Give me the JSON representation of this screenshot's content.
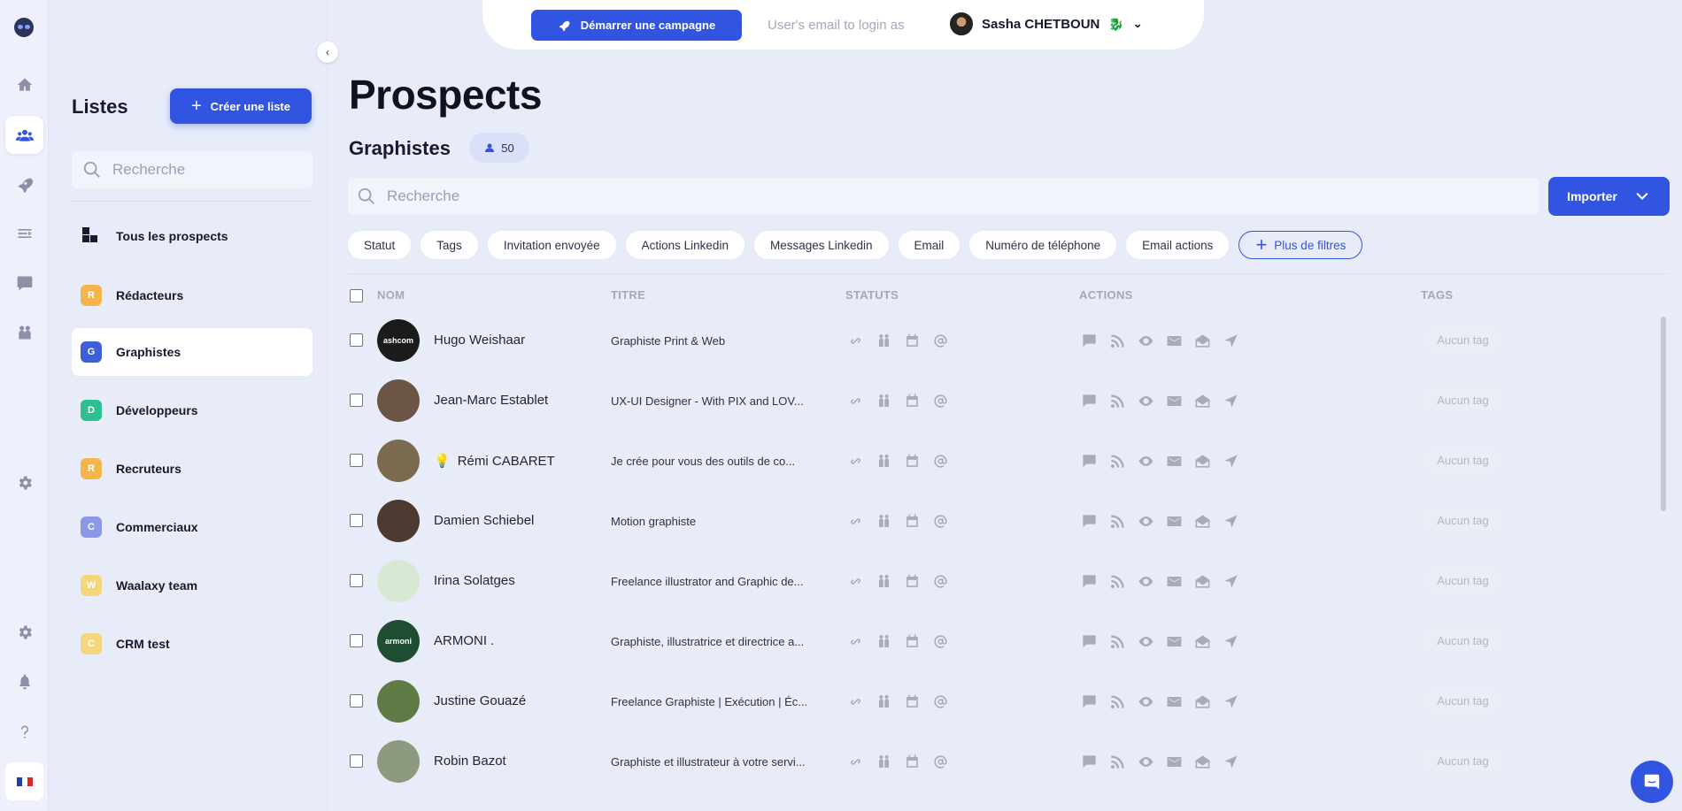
{
  "topbar": {
    "start_campaign": "Démarrer une campagne",
    "login_as_placeholder": "User's email to login as",
    "user_name": "Sasha CHETBOUN"
  },
  "lists_panel": {
    "title": "Listes",
    "create_label": "Créer une liste",
    "search_placeholder": "Recherche",
    "items": [
      {
        "label": "Tous les prospects",
        "badge": "",
        "color": ""
      },
      {
        "label": "Rédacteurs",
        "badge": "R",
        "color": "#f6b54a"
      },
      {
        "label": "Graphistes",
        "badge": "G",
        "color": "#3f5fd8"
      },
      {
        "label": "Développeurs",
        "badge": "D",
        "color": "#2fbf8f"
      },
      {
        "label": "Recruteurs",
        "badge": "R",
        "color": "#f6b54a"
      },
      {
        "label": "Commerciaux",
        "badge": "C",
        "color": "#8a98e6"
      },
      {
        "label": "Waalaxy team",
        "badge": "W",
        "color": "#f6d67a"
      },
      {
        "label": "CRM test",
        "badge": "C",
        "color": "#f6d67a"
      }
    ]
  },
  "main": {
    "title": "Prospects",
    "list_name": "Graphistes",
    "count": "50",
    "search_placeholder": "Recherche",
    "import_label": "Importer",
    "filters": [
      "Statut",
      "Tags",
      "Invitation envoyée",
      "Actions Linkedin",
      "Messages Linkedin",
      "Email",
      "Numéro de téléphone",
      "Email actions"
    ],
    "more_filters": "Plus de filtres",
    "columns": {
      "name": "NOM",
      "title": "TITRE",
      "status": "STATUTS",
      "actions": "ACTIONS",
      "tags": "TAGS"
    },
    "rows": [
      {
        "name": "Hugo Weishaar",
        "job": "Graphiste Print & Web",
        "tag": "Aucun tag",
        "avatar_color": "#1b1b1b",
        "avatar_text": "ashcom",
        "bulb": false
      },
      {
        "name": "Jean-Marc Establet",
        "job": "UX-UI Designer - With PIX and LOV...",
        "tag": "Aucun tag",
        "avatar_color": "#6b5646",
        "avatar_text": "",
        "bulb": false
      },
      {
        "name": "Rémi CABARET",
        "job": "Je crée pour vous des outils de co...",
        "tag": "Aucun tag",
        "avatar_color": "#7a6a4e",
        "avatar_text": "",
        "bulb": true
      },
      {
        "name": "Damien Schiebel",
        "job": "Motion graphiste",
        "tag": "Aucun tag",
        "avatar_color": "#4a3a30",
        "avatar_text": "",
        "bulb": false
      },
      {
        "name": "Irina Solatges",
        "job": "Freelance illustrator and Graphic de...",
        "tag": "Aucun tag",
        "avatar_color": "#d9e8d2",
        "avatar_text": "",
        "bulb": false
      },
      {
        "name": "ARMONI .",
        "job": "Graphiste, illustratrice et directrice a...",
        "tag": "Aucun tag",
        "avatar_color": "#1f4d32",
        "avatar_text": "armoni",
        "bulb": false
      },
      {
        "name": "Justine Gouazé",
        "job": "Freelance Graphiste | Exécution | Éc...",
        "tag": "Aucun tag",
        "avatar_color": "#5e7a45",
        "avatar_text": "",
        "bulb": false
      },
      {
        "name": "Robin Bazot",
        "job": "Graphiste et illustrateur à votre servi...",
        "tag": "Aucun tag",
        "avatar_color": "#8d9a80",
        "avatar_text": "",
        "bulb": false
      }
    ]
  },
  "colors": {
    "accent": "#3155e0",
    "background": "#e8ecf9"
  }
}
